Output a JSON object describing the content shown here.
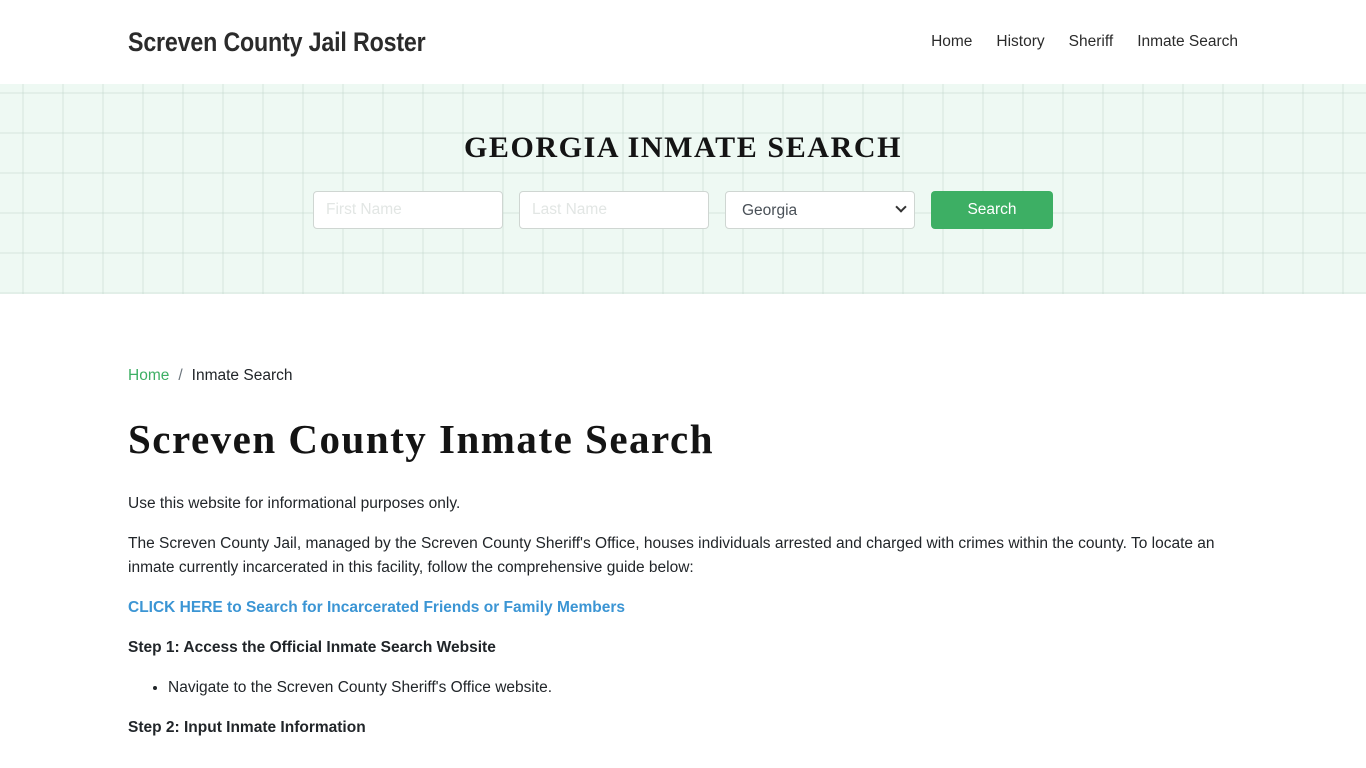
{
  "navbar": {
    "brand": "Screven County Jail Roster",
    "links": [
      {
        "label": "Home"
      },
      {
        "label": "History"
      },
      {
        "label": "Sheriff"
      },
      {
        "label": "Inmate Search"
      }
    ]
  },
  "hero": {
    "title": "GEORGIA INMATE SEARCH",
    "first_name_placeholder": "First Name",
    "first_name_value": "",
    "last_name_placeholder": "Last Name",
    "last_name_value": "",
    "state_selected": "Georgia",
    "search_label": "Search"
  },
  "breadcrumb": {
    "home": "Home",
    "separator": "/",
    "current": "Inmate Search"
  },
  "main": {
    "title": "Screven County Inmate Search",
    "intro": "Use this website for informational purposes only.",
    "description": "The Screven County Jail, managed by the Screven County Sheriff's Office, houses individuals arrested and charged with crimes within the county. To locate an inmate currently incarcerated in this facility, follow the comprehensive guide below:",
    "cta_link": "CLICK HERE to Search for Incarcerated Friends or Family Members",
    "steps": [
      {
        "heading": "Step 1: Access the Official Inmate Search Website",
        "bullets": [
          "Navigate to the Screven County Sheriff's Office website."
        ]
      },
      {
        "heading": "Step 2: Input Inmate Information",
        "bullets": []
      }
    ]
  },
  "colors": {
    "accent_green": "#3daf64",
    "link_blue": "#3b95d4",
    "hero_bg": "#eef9f3"
  }
}
